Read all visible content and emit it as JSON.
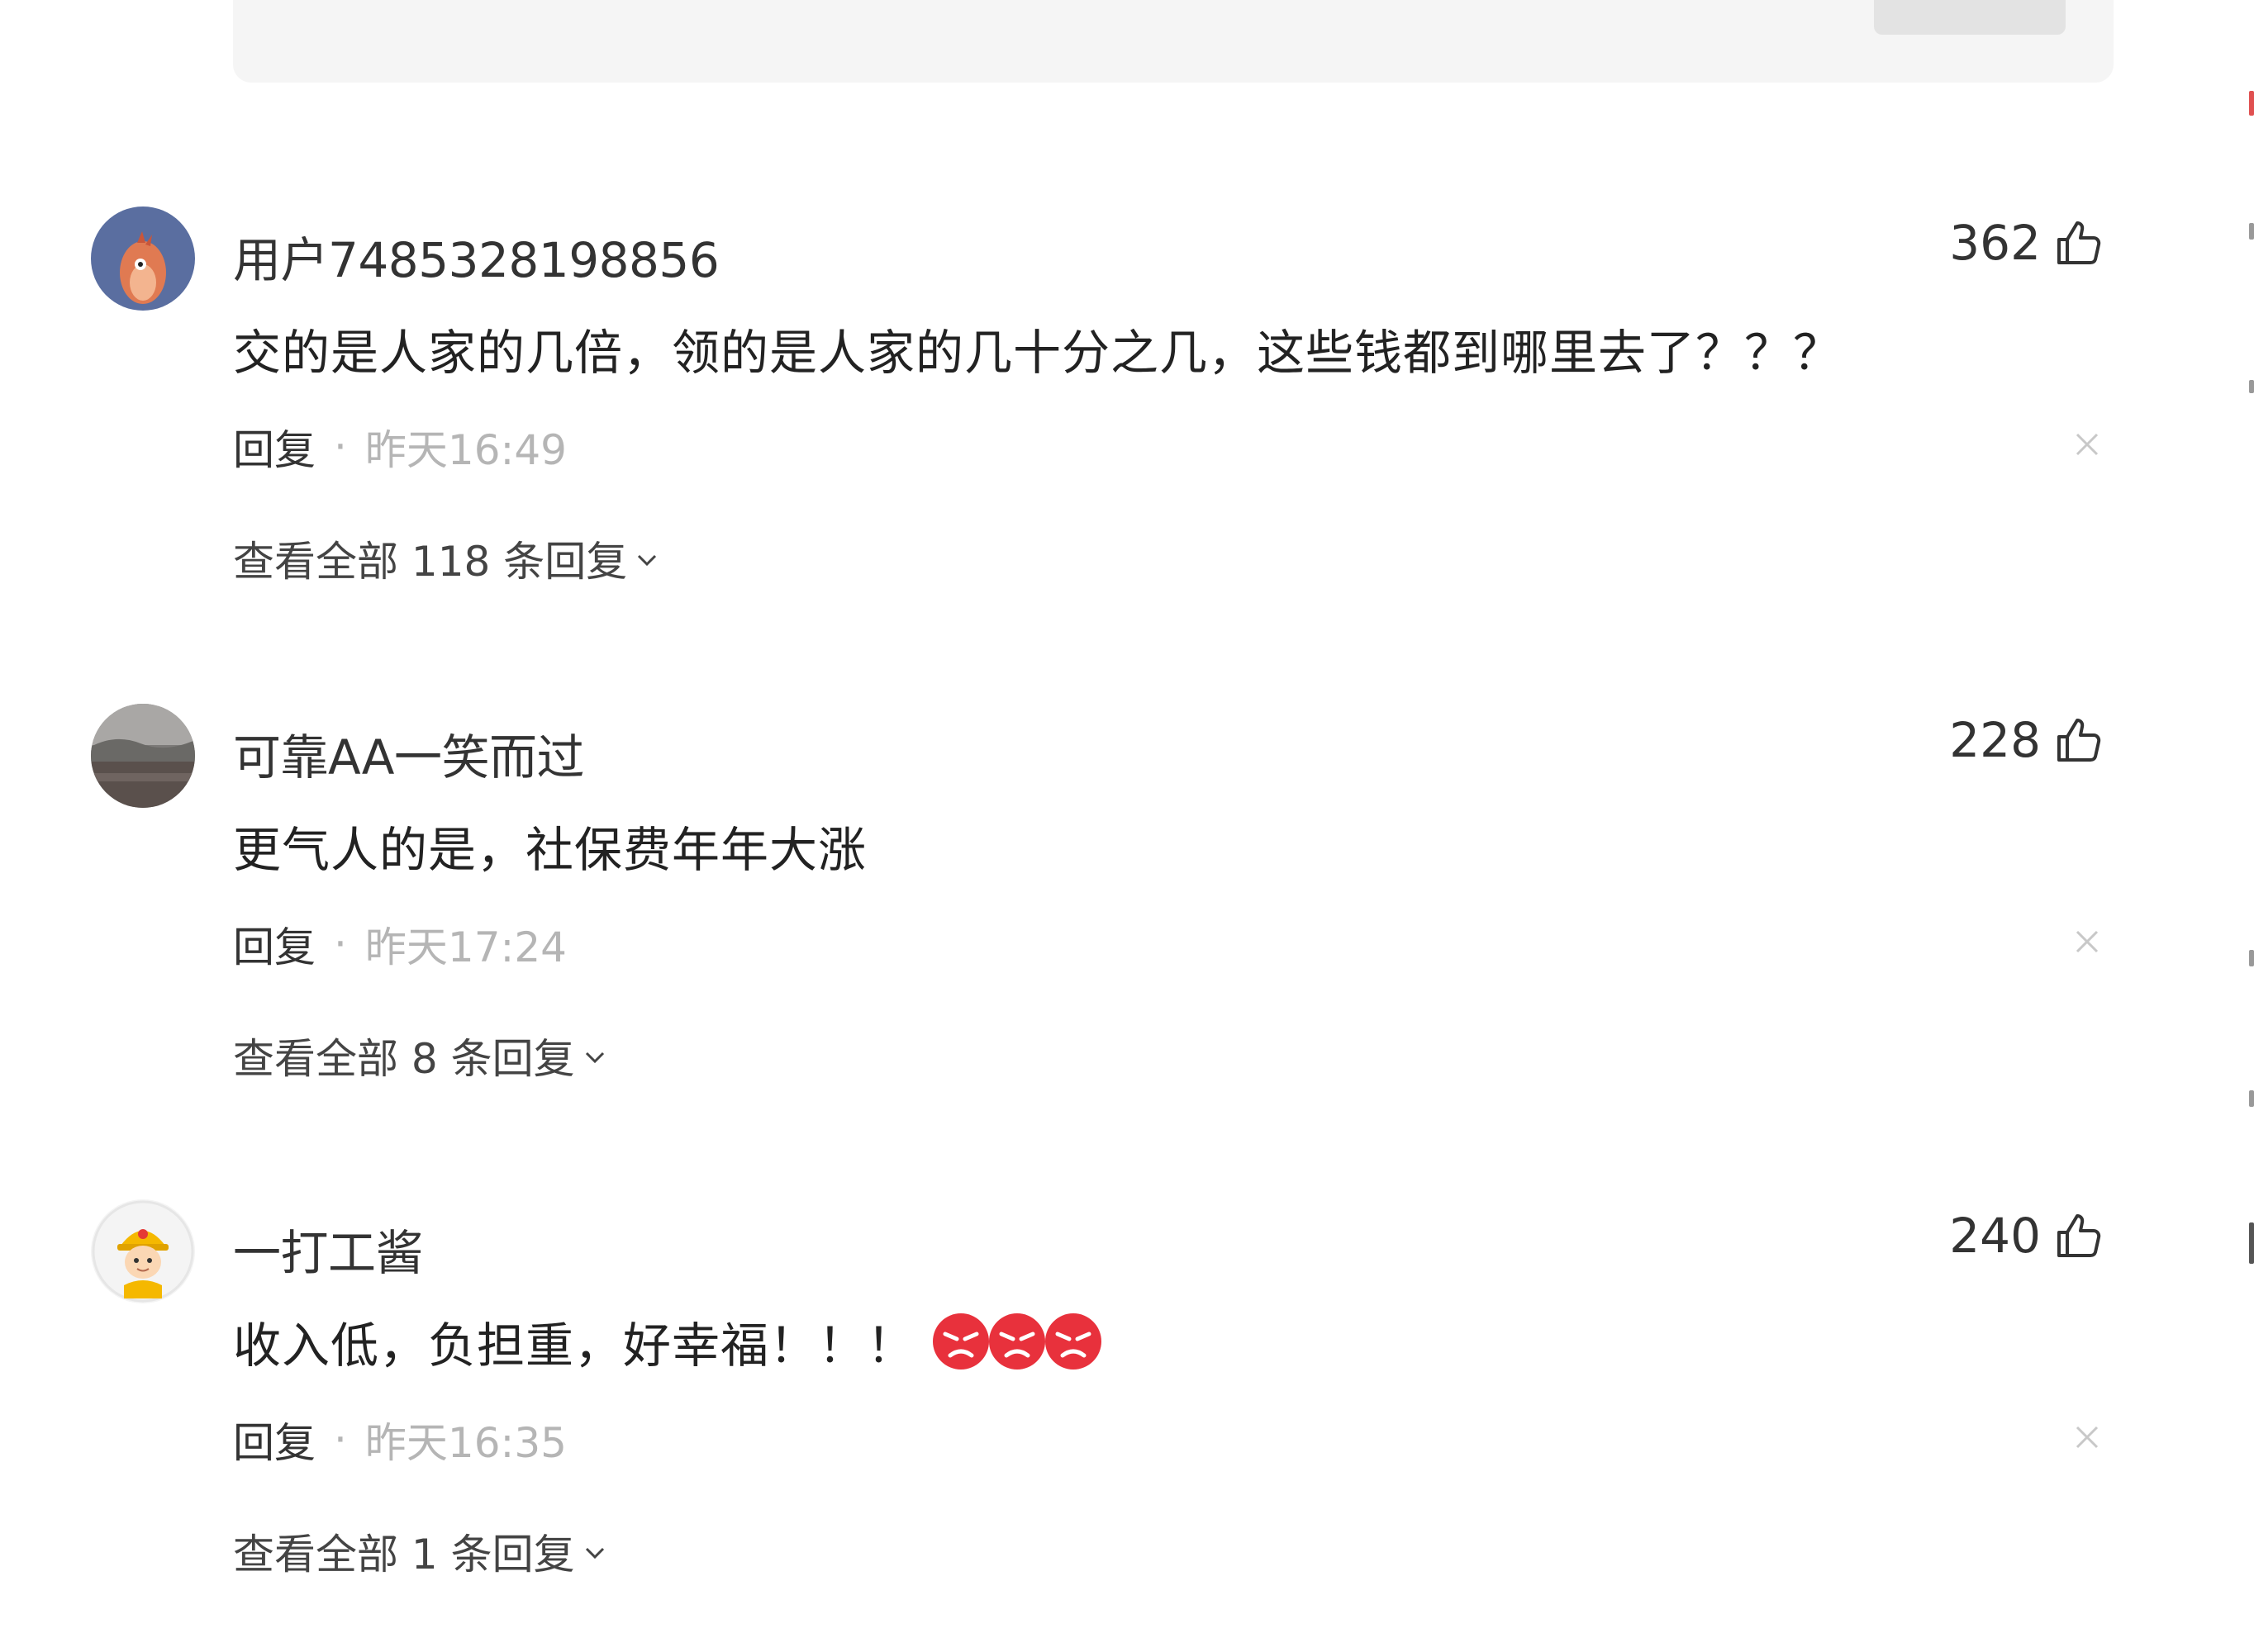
{
  "composer": {
    "publish_label": ""
  },
  "comments": [
    {
      "username": "用户7485328198856",
      "likes": "362",
      "content": "交的是人家的几倍，领的是人家的几十分之几，这些钱都到哪里去了？？？",
      "reply_label": "回复",
      "separator": "·",
      "time": "昨天16:49",
      "view_replies": "查看全部 118 条回复",
      "avatar_icon": "cartoon-bird-avatar"
    },
    {
      "username": "可靠AA一笑而过",
      "likes": "228",
      "content": "更气人的是，社保费年年大涨",
      "reply_label": "回复",
      "separator": "·",
      "time": "昨天17:24",
      "view_replies": "查看全部 8 条回复",
      "avatar_icon": "landscape-photo-avatar"
    },
    {
      "username": "一打工酱",
      "likes": "240",
      "content": "收入低，负担重，好幸福！！！",
      "reply_label": "回复",
      "separator": "·",
      "time": "昨天16:35",
      "view_replies": "查看全部 1 条回复",
      "avatar_icon": "worker-helmet-avatar",
      "emojis": [
        "angry-emoji",
        "angry-emoji",
        "angry-emoji"
      ]
    }
  ],
  "colors": {
    "text": "#222222",
    "muted": "#b5b5b5",
    "emoji_red": "#e8313c"
  }
}
